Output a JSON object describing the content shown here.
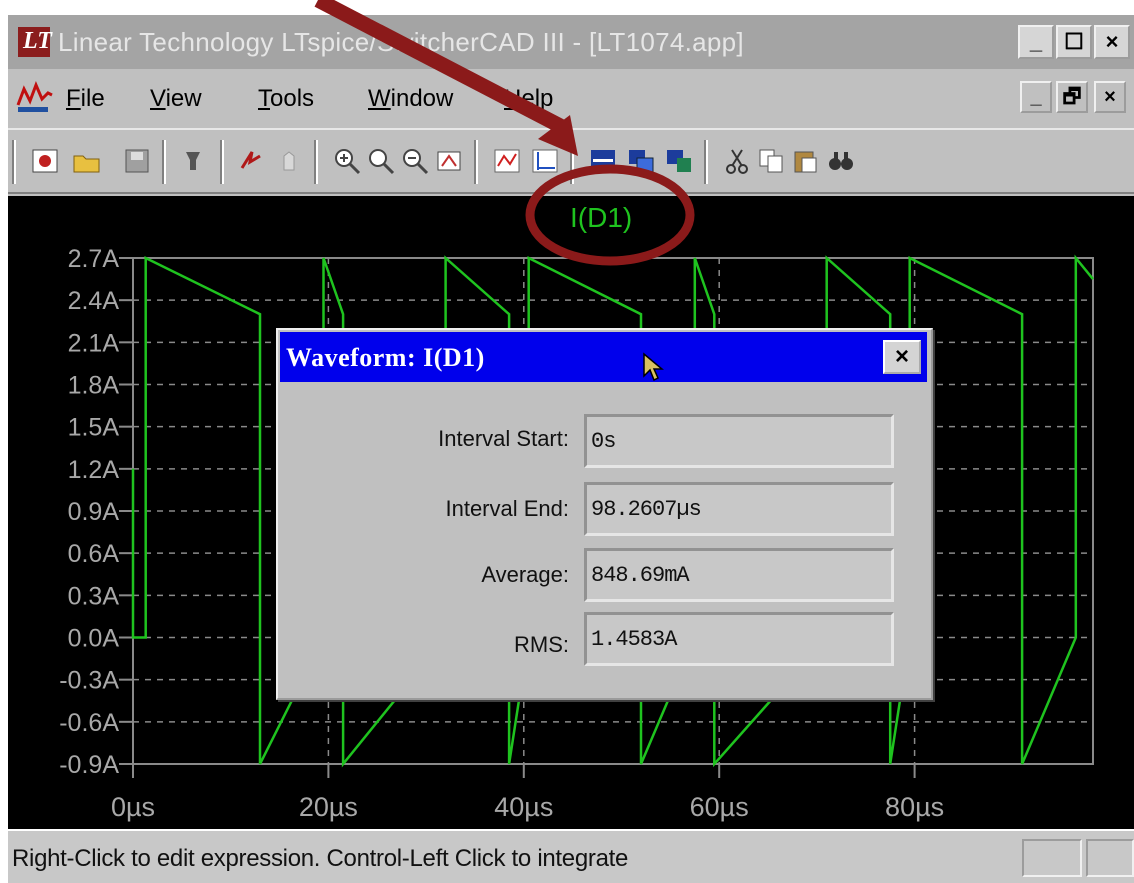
{
  "window": {
    "title": "Linear Technology LTspice/SwitcherCAD III - [LT1074.app]",
    "buttons": [
      "_",
      "☐",
      "×"
    ]
  },
  "menu": {
    "items": [
      "File",
      "View",
      "Tools",
      "Window",
      "Help"
    ],
    "doc_buttons": [
      "_",
      "🗗",
      "×"
    ]
  },
  "toolbar": {
    "icons": [
      "new-schematic-icon",
      "open-icon",
      "save-icon",
      "control-panel-icon",
      "run-icon",
      "halt-icon",
      "zoom-in-icon",
      "pan-icon",
      "zoom-out-icon",
      "zoom-fit-icon",
      "add-trace-icon",
      "add-plot-pane-icon",
      "tile-horizontal-icon",
      "cascade-icon",
      "tile-icon",
      "cut-icon",
      "copy-icon",
      "paste-icon",
      "find-icon"
    ]
  },
  "plot": {
    "trace_label": "I(D1)",
    "trace_color": "#1fc31f",
    "background": "#000000"
  },
  "chart_data": {
    "type": "line",
    "title": "I(D1)",
    "xlabel": "",
    "ylabel": "",
    "x_ticks": [
      "0µs",
      "20µs",
      "40µs",
      "60µs",
      "80µs"
    ],
    "y_ticks": [
      "2.7A",
      "2.4A",
      "2.1A",
      "1.8A",
      "1.5A",
      "1.2A",
      "0.9A",
      "0.6A",
      "0.3A",
      "0.0A",
      "-0.3A",
      "-0.6A",
      "-0.9A"
    ],
    "xlim": [
      0,
      98.26
    ],
    "ylim": [
      -0.9,
      2.7
    ],
    "grid": true,
    "series": [
      {
        "x": [
          0,
          0,
          1.3,
          1.3,
          13,
          13,
          19.5,
          19.5,
          21.5,
          21.5,
          32,
          32,
          38.5,
          38.5,
          40.5,
          40.5,
          52,
          52,
          57.5,
          57.5,
          59.5,
          59.5,
          71,
          71,
          77.5,
          77.5,
          79.5,
          79.5,
          91,
          91,
          96.5,
          96.5,
          98.26
        ],
        "y": [
          1.2,
          0.0,
          0.0,
          2.7,
          2.3,
          -0.9,
          0.0,
          2.7,
          2.3,
          -0.9,
          0.0,
          2.7,
          2.3,
          -0.9,
          0.0,
          2.7,
          2.3,
          -0.9,
          0.0,
          2.7,
          2.3,
          -0.9,
          0.0,
          2.7,
          2.3,
          -0.9,
          0.0,
          2.7,
          2.3,
          -0.9,
          0.0,
          2.7,
          2.55
        ]
      }
    ]
  },
  "dialog": {
    "title": "Waveform: I(D1)",
    "close": "×",
    "fields": [
      {
        "label": "Interval Start:",
        "value": "0s"
      },
      {
        "label": "Interval End:",
        "value": "98.2607µs"
      },
      {
        "label": "Average:",
        "value": "848.69mA"
      },
      {
        "label": "RMS:",
        "value": "1.4583A"
      }
    ]
  },
  "status": {
    "text": "Right-Click to edit expression. Control-Left Click to integrate"
  },
  "annotation": {
    "arrow_color": "#8b1a1a",
    "circle_color": "#8b1a1a"
  }
}
